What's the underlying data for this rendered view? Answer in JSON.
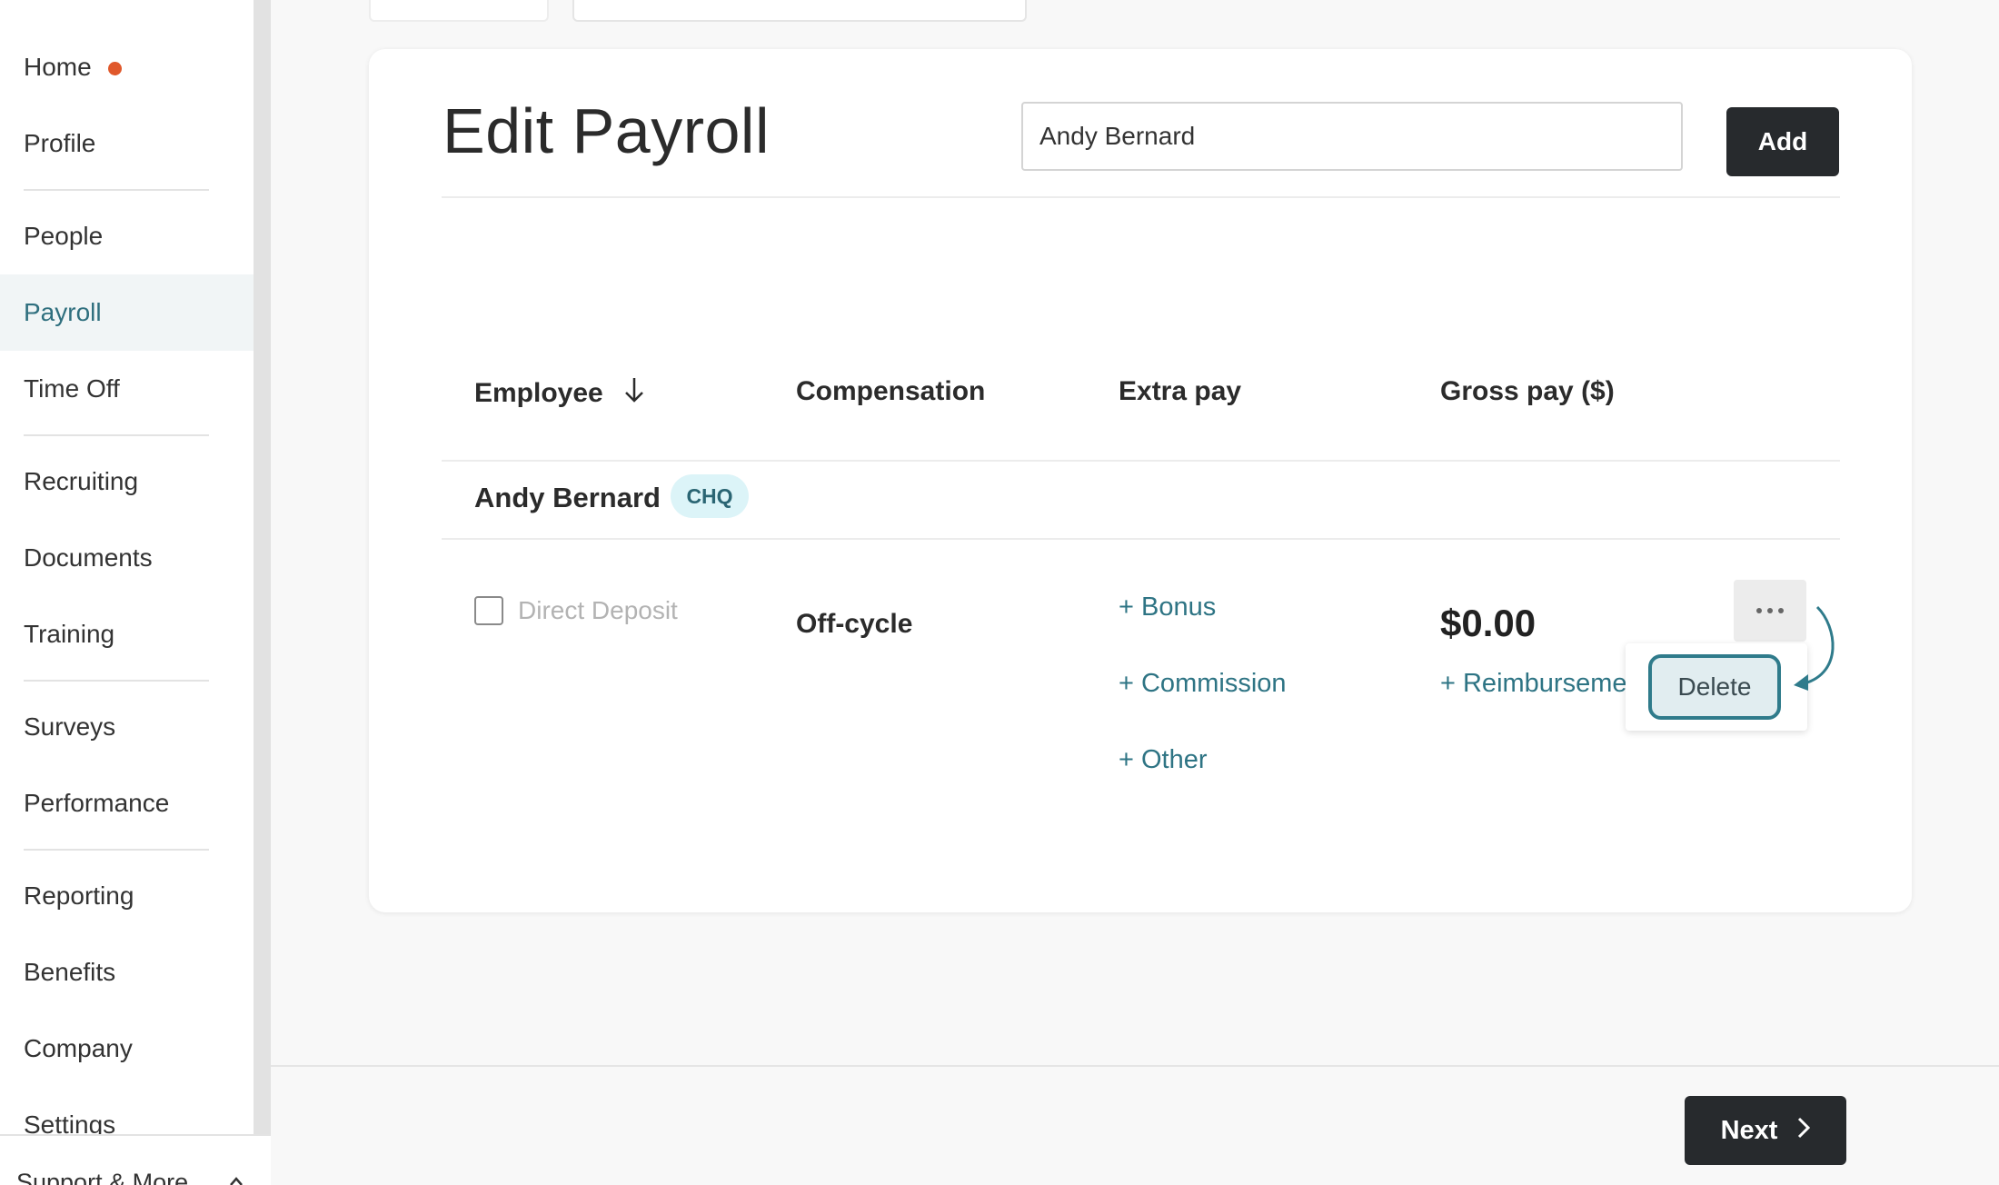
{
  "sidebar": {
    "items": [
      {
        "label": "Home"
      },
      {
        "label": "Profile"
      },
      {
        "label": "People"
      },
      {
        "label": "Payroll"
      },
      {
        "label": "Time Off"
      },
      {
        "label": "Recruiting"
      },
      {
        "label": "Documents"
      },
      {
        "label": "Training"
      },
      {
        "label": "Surveys"
      },
      {
        "label": "Performance"
      },
      {
        "label": "Reporting"
      },
      {
        "label": "Benefits"
      },
      {
        "label": "Company"
      },
      {
        "label": "Settings"
      }
    ],
    "active": "Payroll",
    "support_label": "Support & More",
    "notification_color": "#e0582b"
  },
  "main": {
    "title": "Edit Payroll",
    "search_value": "Andy Bernard",
    "add_label": "Add",
    "columns": [
      "Employee",
      "Compensation",
      "Extra pay",
      "Gross pay ($)"
    ],
    "employee": {
      "name": "Andy Bernard",
      "badge": "CHQ",
      "direct_deposit_label": "Direct Deposit",
      "compensation": "Off-cycle",
      "extra_pay_links": [
        "+ Bonus",
        "+ Commission",
        "+ Other"
      ],
      "gross_pay": "$0.00",
      "reimbursement_link": "+ Reimburseme"
    },
    "menu": {
      "delete_label": "Delete"
    },
    "next_label": "Next"
  },
  "colors": {
    "accent": "#2e7484",
    "dark_button": "#272a2d",
    "badge_bg": "#dcf4f8"
  }
}
